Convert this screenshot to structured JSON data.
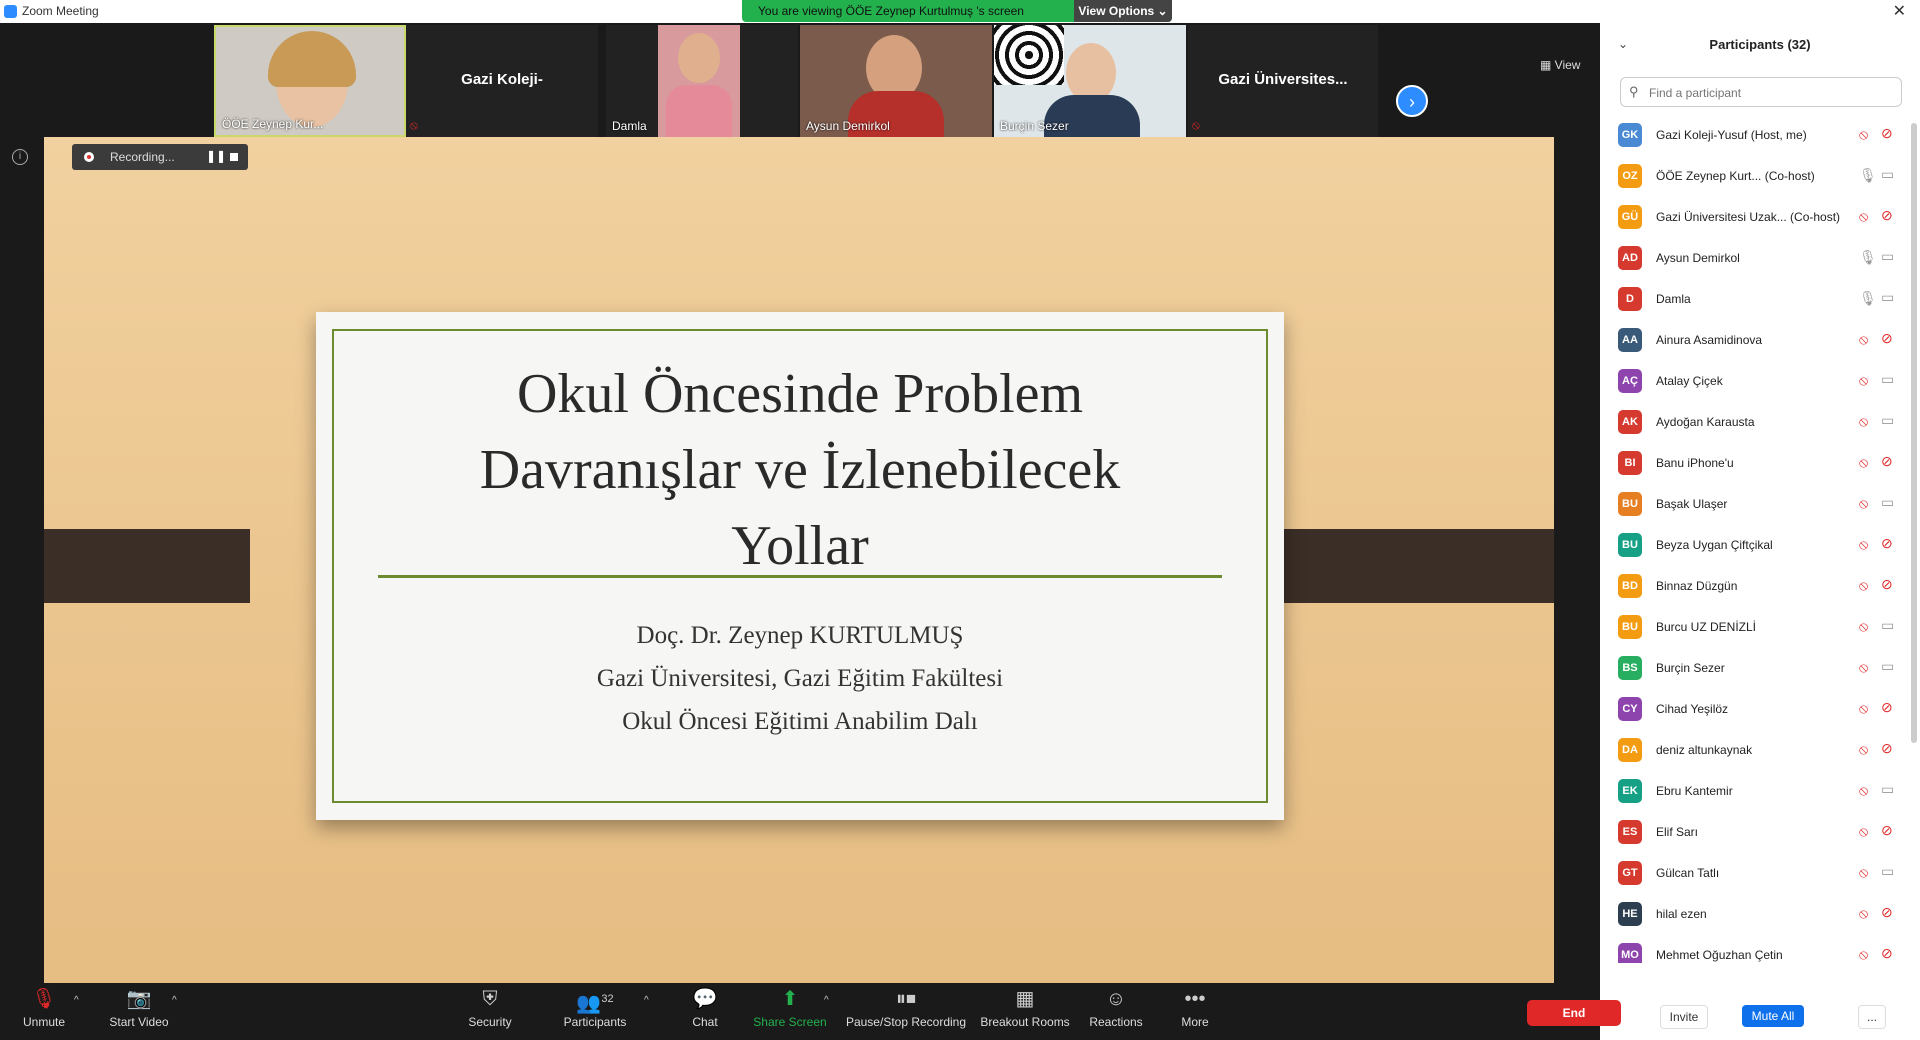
{
  "window": {
    "title": "Zoom Meeting",
    "close_glyph": "✕"
  },
  "banner": {
    "text": "You are viewing ÖÖE Zeynep Kurtulmuş 's screen",
    "options_label": "View Options ⌄"
  },
  "gallery": {
    "tiles": [
      {
        "name": "ÖÖE Zeynep Kur..."
      },
      {
        "name": "Gazi Koleji-"
      },
      {
        "name": "Damla"
      },
      {
        "name": "Aysun Demirkol"
      },
      {
        "name": "Burçin Sezer"
      },
      {
        "name": "Gazi  Üniversites..."
      }
    ],
    "view_label": "View",
    "next_glyph": "›"
  },
  "recording": {
    "label": "Recording...",
    "pause_glyph": "❚❚"
  },
  "slide": {
    "title_lines": [
      "Okul Öncesinde Problem",
      "Davranışlar ve İzlenebilecek",
      "Yollar"
    ],
    "author": "Doç. Dr. Zeynep KURTULMUŞ",
    "institution": "Gazi Üniversitesi,   Gazi Eğitim Fakültesi",
    "department": "Okul Öncesi Eğitimi Anabilim Dalı"
  },
  "toolbar": {
    "unmute": "Unmute",
    "start_video": "Start Video",
    "security": "Security",
    "participants": "Participants",
    "participants_count": "32",
    "chat": "Chat",
    "share_screen": "Share Screen",
    "pause_stop_recording": "Pause/Stop Recording",
    "breakout_rooms": "Breakout Rooms",
    "reactions": "Reactions",
    "more": "More",
    "end": "End",
    "caret_glyph": "^"
  },
  "panel": {
    "title": "Participants (32)",
    "collapse_glyph": "⌄",
    "search_placeholder": "Find a participant",
    "participants": [
      {
        "initials": "GK",
        "name": "Gazi Koleji-Yusuf (Host, me)",
        "color": "#4a8ad4",
        "mic": "muted",
        "video": "off"
      },
      {
        "initials": "OZ",
        "name": "ÖÖE Zeynep Kurt...  (Co-host)",
        "color": "#f39c12",
        "mic": "on",
        "video": "on"
      },
      {
        "initials": "GÜ",
        "name": "Gazi Üniversitesi Uzak...  (Co-host)",
        "color": "#f39c12",
        "mic": "muted",
        "video": "off"
      },
      {
        "initials": "AD",
        "name": "Aysun Demirkol",
        "color": "#d63a2f",
        "mic": "on",
        "video": "on"
      },
      {
        "initials": "D",
        "name": "Damla",
        "color": "#d63a2f",
        "mic": "on",
        "video": "on"
      },
      {
        "initials": "AA",
        "name": "Ainura Asamidinova",
        "color": "#3a5a7a",
        "mic": "muted",
        "video": "off"
      },
      {
        "initials": "AÇ",
        "name": "Atalay Çiçek",
        "color": "#8e44ad",
        "mic": "muted",
        "video": "on"
      },
      {
        "initials": "AK",
        "name": "Aydoğan Karausta",
        "color": "#d63a2f",
        "mic": "muted",
        "video": "on"
      },
      {
        "initials": "BI",
        "name": "Banu iPhone'u",
        "color": "#d63a2f",
        "mic": "muted",
        "video": "off"
      },
      {
        "initials": "BU",
        "name": "Başak Ulaşer",
        "color": "#e67e22",
        "mic": "muted",
        "video": "on"
      },
      {
        "initials": "BU",
        "name": "Beyza Uygan Çiftçikal",
        "color": "#16a085",
        "mic": "muted",
        "video": "off"
      },
      {
        "initials": "BD",
        "name": "Binnaz Düzgün",
        "color": "#f39c12",
        "mic": "muted",
        "video": "off"
      },
      {
        "initials": "BU",
        "name": "Burcu UZ DENİZLİ",
        "color": "#f39c12",
        "mic": "muted",
        "video": "on"
      },
      {
        "initials": "BS",
        "name": "Burçin Sezer",
        "color": "#27ae60",
        "mic": "muted",
        "video": "on"
      },
      {
        "initials": "CY",
        "name": "Cihad Yeşilöz",
        "color": "#8e44ad",
        "mic": "muted",
        "video": "off"
      },
      {
        "initials": "DA",
        "name": "deniz altunkaynak",
        "color": "#f39c12",
        "mic": "muted",
        "video": "off"
      },
      {
        "initials": "EK",
        "name": "Ebru Kantemir",
        "color": "#16a085",
        "mic": "muted",
        "video": "on"
      },
      {
        "initials": "ES",
        "name": "Elif Sarı",
        "color": "#d63a2f",
        "mic": "muted",
        "video": "off"
      },
      {
        "initials": "GT",
        "name": "Gülcan Tatlı",
        "color": "#d63a2f",
        "mic": "muted",
        "video": "on"
      },
      {
        "initials": "HE",
        "name": "hilal ezen",
        "color": "#2c3e50",
        "mic": "muted",
        "video": "off"
      },
      {
        "initials": "MO",
        "name": "Mehmet Oğuzhan Çetin",
        "color": "#8e44ad",
        "mic": "muted",
        "video": "off"
      }
    ],
    "invite": "Invite",
    "mute_all": "Mute All",
    "more": "..."
  }
}
